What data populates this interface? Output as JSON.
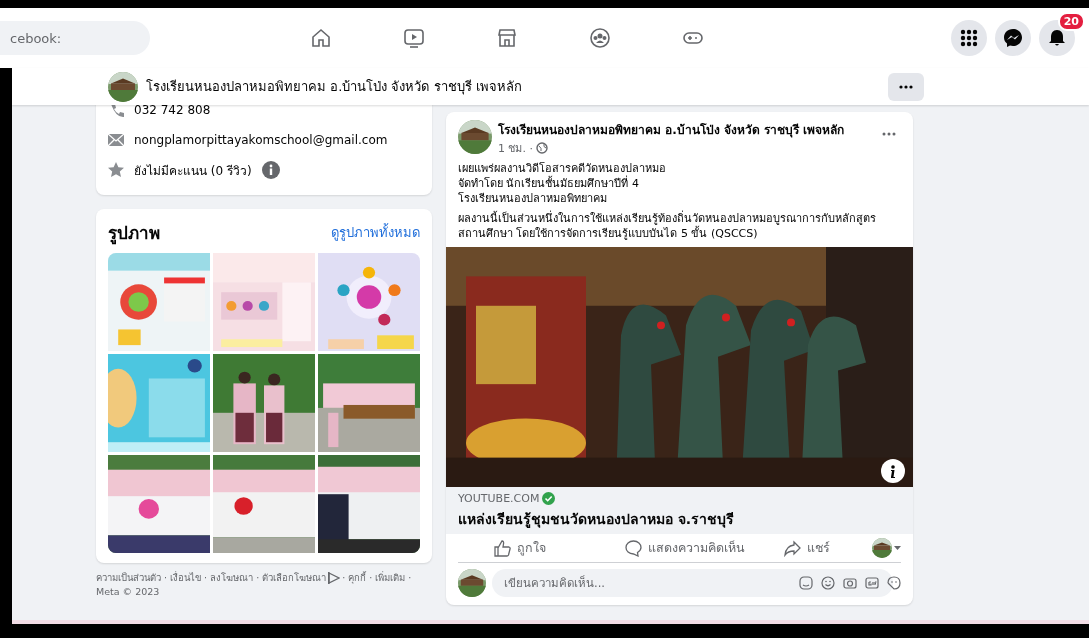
{
  "top_nav": {
    "search": {
      "placeholder": "cebook:"
    },
    "notification_count": "20"
  },
  "page_bar": {
    "name": "โรงเรียนหนองปลาหมอพิทยาคม อ.บ้านโป่ง จังหวัด ราชบุรี เพจหลัก"
  },
  "info": {
    "phone": "032 742 808",
    "email": "nongplamorpittayakomschool@gmail.com",
    "rating": "ยังไม่มีคะแนน (0 รีวิว)"
  },
  "photos": {
    "title": "รูปภาพ",
    "see_all": "ดูรูปภาพทั้งหมด"
  },
  "footer": {
    "text_before": "ความเป็นส่วนตัว · เงื่อนไข · ลงโฆษณา · ตัวเลือกโฆษณา",
    "text_after": "· คุกกี้ · เพิ่มเติม ·",
    "copyright": "Meta © 2023"
  },
  "post": {
    "author": "โรงเรียนหนองปลาหมอพิทยาคม อ.บ้านโป่ง จังหวัด ราชบุรี เพจหลัก",
    "time": "1 ชม. ·",
    "body": [
      {
        "kind": "line",
        "text": "เผยแพร่ผลงานวิดีโอสารคดีวัดหนองปลาหมอ"
      },
      {
        "kind": "line",
        "text": "จัดทำโดย นักเรียนชั้นมัธยมศึกษาปีที่ 4"
      },
      {
        "kind": "line",
        "text": "โรงเรียนหนองปลาหมอพิทยาคม"
      },
      {
        "kind": "paragraph",
        "text": "ผลงานนี้เป็นส่วนหนึ่งในการใช้แหล่งเรียนรู้ท้องถิ่นวัดหนองปลาหมอบูรณาการกับหลักสูตรสถานศึกษา โดยใช้การจัดการเรียนรู้แบบบันได 5 ขั้น (QSCCS)"
      }
    ],
    "link": {
      "domain": "YOUTUBE.COM",
      "verified": true,
      "title": "แหล่งเรียนรู้ชุมชนวัดหนองปลาหมอ จ.ราชบุรี"
    },
    "actions": [
      {
        "kind": "like",
        "label": "ถูกใจ"
      },
      {
        "kind": "comment",
        "label": "แสดงความคิดเห็น"
      },
      {
        "kind": "share",
        "label": "แชร์"
      }
    ],
    "comment": {
      "placeholder": "เขียนความคิดเห็น..."
    }
  }
}
